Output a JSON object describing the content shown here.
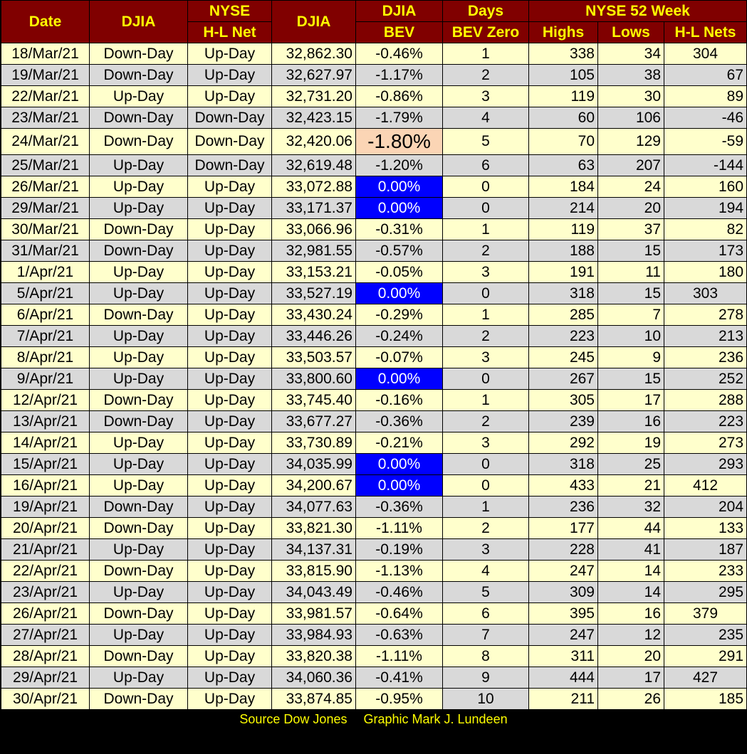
{
  "headers": {
    "date": "Date",
    "djia_dir": "DJIA",
    "nyse_top": "NYSE",
    "nyse_bottom": "H-L Net",
    "djia": "DJIA",
    "bev_top": "DJIA",
    "bev_bottom": "BEV",
    "days_top": "Days",
    "days_bottom": "BEV Zero",
    "nyse52": "NYSE 52 Week",
    "highs": "Highs",
    "lows": "Lows",
    "nets": "H-L Nets"
  },
  "colors": {
    "header_bg": "#800000",
    "header_text": "#FFFF00",
    "row_odd": "#FFFFCC",
    "row_even": "#D9D9D9",
    "bev_zero": "#0000FF",
    "bev_low": "#FBD5B5"
  },
  "rows": [
    [
      "18/Mar/21",
      "Down-Day",
      "Up-Day",
      "32,862.30",
      "-0.46%",
      "1",
      "338",
      "34",
      "304"
    ],
    [
      "19/Mar/21",
      "Down-Day",
      "Up-Day",
      "32,627.97",
      "-1.17%",
      "2",
      "105",
      "38",
      "67"
    ],
    [
      "22/Mar/21",
      "Up-Day",
      "Up-Day",
      "32,731.20",
      "-0.86%",
      "3",
      "119",
      "30",
      "89"
    ],
    [
      "23/Mar/21",
      "Down-Day",
      "Down-Day",
      "32,423.15",
      "-1.79%",
      "4",
      "60",
      "106",
      "-46"
    ],
    [
      "24/Mar/21",
      "Down-Day",
      "Down-Day",
      "32,420.06",
      "-1.80%",
      "5",
      "70",
      "129",
      "-59"
    ],
    [
      "25/Mar/21",
      "Up-Day",
      "Down-Day",
      "32,619.48",
      "-1.20%",
      "6",
      "63",
      "207",
      "-144"
    ],
    [
      "26/Mar/21",
      "Up-Day",
      "Up-Day",
      "33,072.88",
      "0.00%",
      "0",
      "184",
      "24",
      "160"
    ],
    [
      "29/Mar/21",
      "Up-Day",
      "Up-Day",
      "33,171.37",
      "0.00%",
      "0",
      "214",
      "20",
      "194"
    ],
    [
      "30/Mar/21",
      "Down-Day",
      "Up-Day",
      "33,066.96",
      "-0.31%",
      "1",
      "119",
      "37",
      "82"
    ],
    [
      "31/Mar/21",
      "Down-Day",
      "Up-Day",
      "32,981.55",
      "-0.57%",
      "2",
      "188",
      "15",
      "173"
    ],
    [
      "1/Apr/21",
      "Up-Day",
      "Up-Day",
      "33,153.21",
      "-0.05%",
      "3",
      "191",
      "11",
      "180"
    ],
    [
      "5/Apr/21",
      "Up-Day",
      "Up-Day",
      "33,527.19",
      "0.00%",
      "0",
      "318",
      "15",
      "303"
    ],
    [
      "6/Apr/21",
      "Down-Day",
      "Up-Day",
      "33,430.24",
      "-0.29%",
      "1",
      "285",
      "7",
      "278"
    ],
    [
      "7/Apr/21",
      "Up-Day",
      "Up-Day",
      "33,446.26",
      "-0.24%",
      "2",
      "223",
      "10",
      "213"
    ],
    [
      "8/Apr/21",
      "Up-Day",
      "Up-Day",
      "33,503.57",
      "-0.07%",
      "3",
      "245",
      "9",
      "236"
    ],
    [
      "9/Apr/21",
      "Up-Day",
      "Up-Day",
      "33,800.60",
      "0.00%",
      "0",
      "267",
      "15",
      "252"
    ],
    [
      "12/Apr/21",
      "Down-Day",
      "Up-Day",
      "33,745.40",
      "-0.16%",
      "1",
      "305",
      "17",
      "288"
    ],
    [
      "13/Apr/21",
      "Down-Day",
      "Up-Day",
      "33,677.27",
      "-0.36%",
      "2",
      "239",
      "16",
      "223"
    ],
    [
      "14/Apr/21",
      "Up-Day",
      "Up-Day",
      "33,730.89",
      "-0.21%",
      "3",
      "292",
      "19",
      "273"
    ],
    [
      "15/Apr/21",
      "Up-Day",
      "Up-Day",
      "34,035.99",
      "0.00%",
      "0",
      "318",
      "25",
      "293"
    ],
    [
      "16/Apr/21",
      "Up-Day",
      "Up-Day",
      "34,200.67",
      "0.00%",
      "0",
      "433",
      "21",
      "412"
    ],
    [
      "19/Apr/21",
      "Down-Day",
      "Up-Day",
      "34,077.63",
      "-0.36%",
      "1",
      "236",
      "32",
      "204"
    ],
    [
      "20/Apr/21",
      "Down-Day",
      "Up-Day",
      "33,821.30",
      "-1.11%",
      "2",
      "177",
      "44",
      "133"
    ],
    [
      "21/Apr/21",
      "Up-Day",
      "Up-Day",
      "34,137.31",
      "-0.19%",
      "3",
      "228",
      "41",
      "187"
    ],
    [
      "22/Apr/21",
      "Down-Day",
      "Up-Day",
      "33,815.90",
      "-1.13%",
      "4",
      "247",
      "14",
      "233"
    ],
    [
      "23/Apr/21",
      "Up-Day",
      "Up-Day",
      "34,043.49",
      "-0.46%",
      "5",
      "309",
      "14",
      "295"
    ],
    [
      "26/Apr/21",
      "Down-Day",
      "Up-Day",
      "33,981.57",
      "-0.64%",
      "6",
      "395",
      "16",
      "379"
    ],
    [
      "27/Apr/21",
      "Up-Day",
      "Up-Day",
      "33,984.93",
      "-0.63%",
      "7",
      "247",
      "12",
      "235"
    ],
    [
      "28/Apr/21",
      "Down-Day",
      "Up-Day",
      "33,820.38",
      "-1.11%",
      "8",
      "311",
      "20",
      "291"
    ],
    [
      "29/Apr/21",
      "Up-Day",
      "Up-Day",
      "34,060.36",
      "-0.41%",
      "9",
      "444",
      "17",
      "427"
    ],
    [
      "30/Apr/21",
      "Down-Day",
      "Up-Day",
      "33,874.85",
      "-0.95%",
      "10",
      "211",
      "26",
      "185"
    ]
  ],
  "bev_low_value": "-1.80%",
  "footer": {
    "source": "Source Dow Jones",
    "graphic": "Graphic Mark J. Lundeen"
  }
}
